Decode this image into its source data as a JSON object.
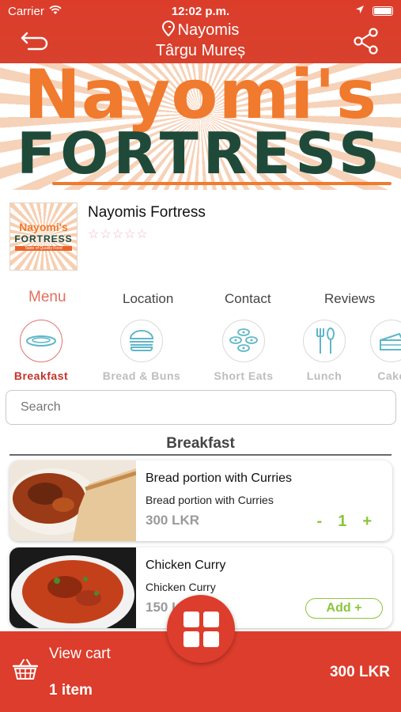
{
  "status_bar": {
    "carrier": "Carrier",
    "time": "12:02 p.m."
  },
  "header": {
    "title": "Nayomis",
    "subtitle": "Târgu Mureș"
  },
  "banner": {
    "line1": "Nayomi's",
    "line2": "FORTRESS"
  },
  "restaurant": {
    "name": "Nayomis Fortress",
    "rating": 0,
    "rating_stars": "☆☆☆☆☆",
    "logo": {
      "line1": "Nayomi's",
      "line2": "FORTRESS",
      "line3": "Taste of Quality Food"
    }
  },
  "tabs": [
    {
      "label": "Menu",
      "active": true
    },
    {
      "label": "Location",
      "active": false
    },
    {
      "label": "Contact",
      "active": false
    },
    {
      "label": "Reviews",
      "active": false
    }
  ],
  "categories": [
    {
      "label": "Breakfast",
      "icon": "plate-icon",
      "active": true
    },
    {
      "label": "Bread & Buns",
      "icon": "burger-icon",
      "active": false
    },
    {
      "label": "Short Eats",
      "icon": "sushi-icon",
      "active": false
    },
    {
      "label": "Lunch",
      "icon": "fork-spoon-icon",
      "active": false
    },
    {
      "label": "Cake",
      "icon": "cake-icon",
      "active": false
    }
  ],
  "search": {
    "placeholder": "Search"
  },
  "section_title": "Breakfast",
  "items": [
    {
      "name": "Bread portion with Curries",
      "description": "Bread portion with Curries",
      "price": "300 LKR",
      "quantity": "1",
      "minus": "-",
      "plus": "+"
    },
    {
      "name": "Chicken Curry",
      "description": "Chicken Curry",
      "price": "150 LKR",
      "add_label": "Add +"
    }
  ],
  "cart": {
    "view_label": "View cart",
    "count_label": "1 item",
    "total": "300 LKR"
  },
  "colors": {
    "primary": "#dd3d2c",
    "accent_green": "#8ac63a",
    "tab_active": "#e26e5e"
  }
}
